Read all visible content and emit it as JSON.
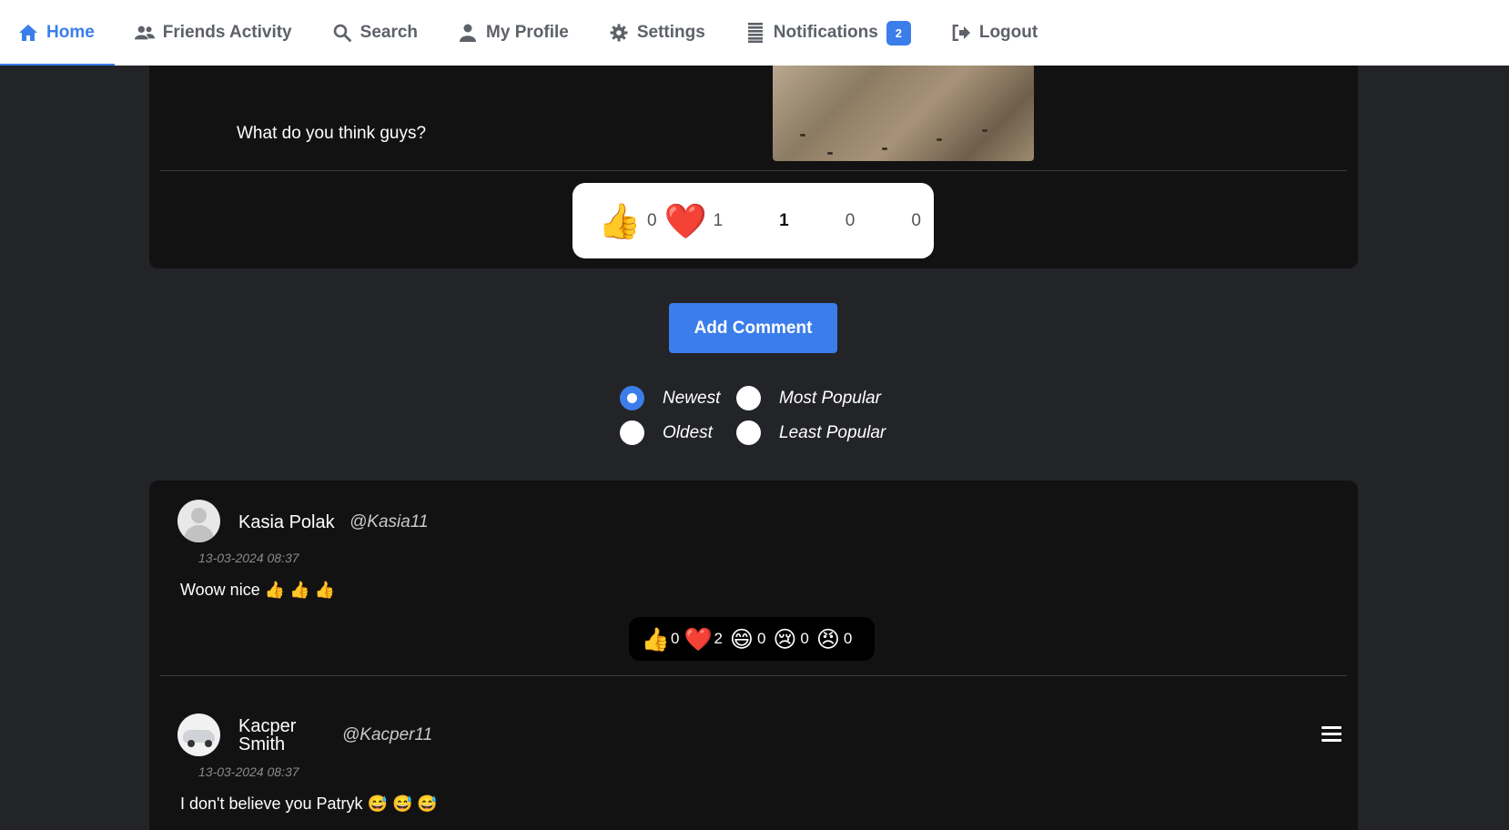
{
  "nav": {
    "items": [
      {
        "label": "Home",
        "icon": "home-icon",
        "active": true
      },
      {
        "label": "Friends Activity",
        "icon": "users-icon"
      },
      {
        "label": "Search",
        "icon": "search-icon"
      },
      {
        "label": "My Profile",
        "icon": "user-icon"
      },
      {
        "label": "Settings",
        "icon": "gear-icon"
      },
      {
        "label": "Notifications",
        "icon": "list-icon",
        "badge": "2"
      },
      {
        "label": "Logout",
        "icon": "logout-icon"
      }
    ],
    "accent_color": "#3b7dea"
  },
  "post": {
    "text": "What do you think guys?",
    "reactions": [
      {
        "emoji": "👍",
        "count": "0"
      },
      {
        "emoji": "❤️",
        "count": "1"
      },
      {
        "emoji": "😄",
        "count": "1"
      },
      {
        "emoji": "😢",
        "count": "0"
      },
      {
        "emoji": "😠",
        "count": "0"
      }
    ]
  },
  "add_comment_label": "Add Comment",
  "sort": {
    "options": [
      {
        "label": "Newest",
        "checked": true
      },
      {
        "label": "Most Popular",
        "checked": false
      },
      {
        "label": "Oldest",
        "checked": false
      },
      {
        "label": "Least Popular",
        "checked": false
      }
    ]
  },
  "comments": [
    {
      "name": "Kasia Polak",
      "handle": "@Kasia11",
      "time": "13-03-2024 08:37",
      "text": "Woow nice 👍 👍 👍",
      "reactions": [
        {
          "emoji": "👍",
          "count": "0"
        },
        {
          "emoji": "❤️",
          "count": "2"
        },
        {
          "emoji": "😄",
          "count": "0"
        },
        {
          "emoji": "😢",
          "count": "0"
        },
        {
          "emoji": "😠",
          "count": "0"
        }
      ]
    },
    {
      "name_line1": "Kacper",
      "name_line2": "Smith",
      "handle": "@Kacper11",
      "time": "13-03-2024 08:37",
      "text": "I don't believe you Patryk 😅 😅 😅"
    }
  ]
}
